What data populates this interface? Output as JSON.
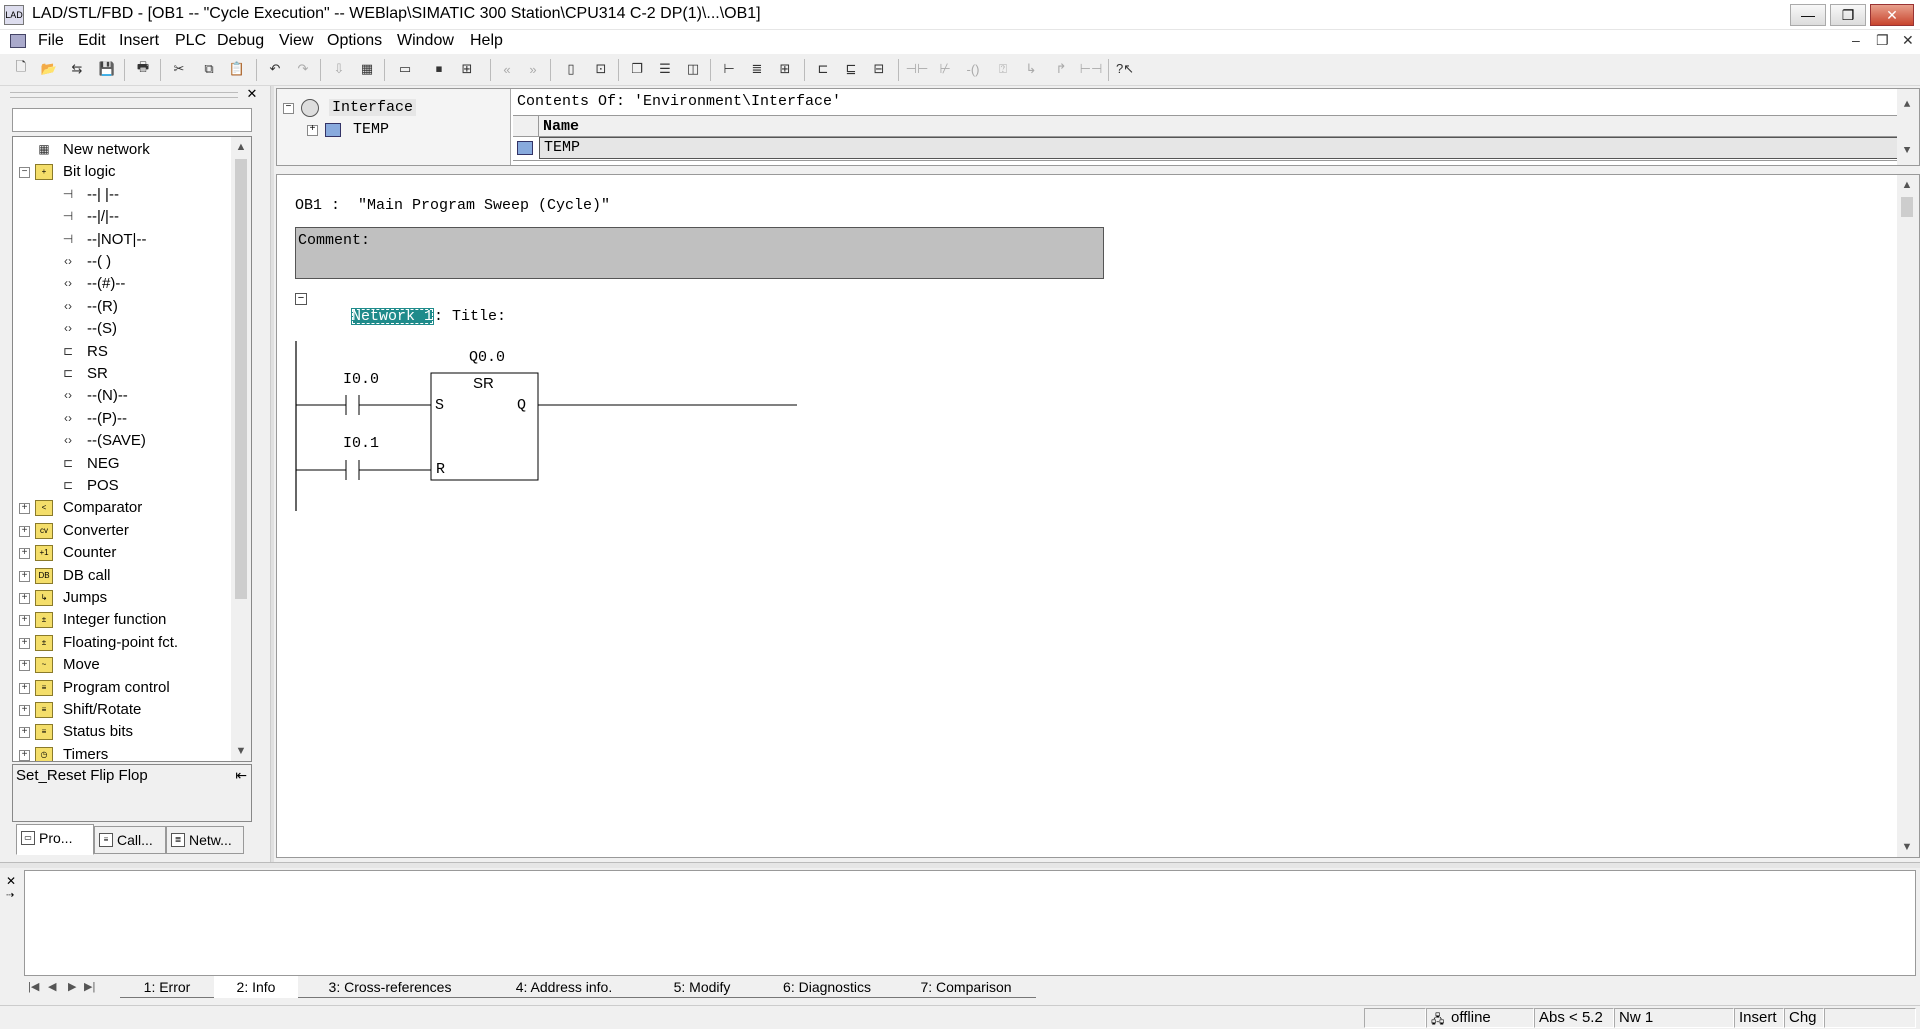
{
  "window": {
    "title": "LAD/STL/FBD  - [OB1 -- \"Cycle Execution\" -- WEBlap\\SIMATIC 300 Station\\CPU314 C-2 DP(1)\\...\\OB1]",
    "minimize": "—",
    "maximize": "❐",
    "close": "✕"
  },
  "menu": [
    "File",
    "Edit",
    "Insert",
    "PLC",
    "Debug",
    "View",
    "Options",
    "Window",
    "Help"
  ],
  "mdi": {
    "minimize": "–",
    "restore": "❐",
    "close": "✕"
  },
  "catalog": {
    "items": [
      {
        "label": "New network",
        "icon": "new-network-icon",
        "glyph": "▦",
        "level": 0
      },
      {
        "label": "Bit logic",
        "icon": "folder-bit-logic-icon",
        "glyph": "+",
        "level": 0,
        "expanded": true
      },
      {
        "label": "--| |--",
        "icon": "contact-icon",
        "glyph": "⊣",
        "level": 1
      },
      {
        "label": "--|/|--",
        "icon": "contact-nc-icon",
        "glyph": "⊣",
        "level": 1
      },
      {
        "label": "--|NOT|--",
        "icon": "not-icon",
        "glyph": "⊣",
        "level": 1
      },
      {
        "label": "--( )",
        "icon": "coil-icon",
        "glyph": "‹›",
        "level": 1
      },
      {
        "label": "--(#)--",
        "icon": "midline-coil-icon",
        "glyph": "‹›",
        "level": 1
      },
      {
        "label": "--(R)",
        "icon": "reset-coil-icon",
        "glyph": "‹›",
        "level": 1
      },
      {
        "label": "--(S)",
        "icon": "set-coil-icon",
        "glyph": "‹›",
        "level": 1
      },
      {
        "label": "RS",
        "icon": "box-icon",
        "glyph": "⊏",
        "level": 1
      },
      {
        "label": "SR",
        "icon": "box-icon",
        "glyph": "⊏",
        "level": 1
      },
      {
        "label": "--(N)--",
        "icon": "neg-edge-coil-icon",
        "glyph": "‹›",
        "level": 1
      },
      {
        "label": "--(P)--",
        "icon": "pos-edge-coil-icon",
        "glyph": "‹›",
        "level": 1
      },
      {
        "label": "--(SAVE)",
        "icon": "save-coil-icon",
        "glyph": "‹›",
        "level": 1
      },
      {
        "label": "NEG",
        "icon": "box-icon",
        "glyph": "⊏",
        "level": 1
      },
      {
        "label": "POS",
        "icon": "box-icon",
        "glyph": "⊏",
        "level": 1
      },
      {
        "label": "Comparator",
        "icon": "folder-comparator-icon",
        "glyph": "<",
        "level": 0
      },
      {
        "label": "Converter",
        "icon": "folder-converter-icon",
        "glyph": "cv",
        "level": 0
      },
      {
        "label": "Counter",
        "icon": "folder-counter-icon",
        "glyph": "+1",
        "level": 0
      },
      {
        "label": "DB call",
        "icon": "folder-db-call-icon",
        "glyph": "DB",
        "level": 0
      },
      {
        "label": "Jumps",
        "icon": "folder-jumps-icon",
        "glyph": "↳",
        "level": 0
      },
      {
        "label": "Integer function",
        "icon": "folder-integer-icon",
        "glyph": "±",
        "level": 0
      },
      {
        "label": "Floating-point fct.",
        "icon": "folder-float-icon",
        "glyph": "±",
        "level": 0
      },
      {
        "label": "Move",
        "icon": "folder-move-icon",
        "glyph": "~",
        "level": 0
      },
      {
        "label": "Program control",
        "icon": "folder-program-control-icon",
        "glyph": "≡",
        "level": 0
      },
      {
        "label": "Shift/Rotate",
        "icon": "folder-shift-icon",
        "glyph": "≡",
        "level": 0
      },
      {
        "label": "Status bits",
        "icon": "folder-status-bits-icon",
        "glyph": "≡",
        "level": 0
      },
      {
        "label": "Timers",
        "icon": "folder-timers-icon",
        "glyph": "◷",
        "level": 0
      }
    ],
    "description": "Set_Reset Flip Flop",
    "tabs": [
      "Pro...",
      "Call...",
      "Netw..."
    ]
  },
  "interface": {
    "tree_root": "Interface",
    "tree_child": "TEMP",
    "contents_title": "Contents Of: 'Environment\\Interface'",
    "column_name": "Name",
    "row_value": "TEMP"
  },
  "editor": {
    "block_header": "OB1 :  \"Main Program Sweep (Cycle)\"",
    "comment_label": "Comment:",
    "network_label": "Network 1",
    "network_title": ": Title:",
    "ladder": {
      "output_address": "Q0.0",
      "box_type": "SR",
      "pin_s": "S",
      "pin_r": "R",
      "pin_q": "Q",
      "contact1_address": "I0.0",
      "contact2_address": "I0.1"
    }
  },
  "output": {
    "tabs": [
      "1: Error",
      "2: Info",
      "3: Cross-references",
      "4: Address info.",
      "5: Modify",
      "6: Diagnostics",
      "7: Comparison"
    ],
    "active_tab": "2: Info"
  },
  "status": {
    "mode": "offline",
    "abs": "Abs < 5.2",
    "network": "Nw 1",
    "insert": "Insert",
    "chg": "Chg"
  }
}
